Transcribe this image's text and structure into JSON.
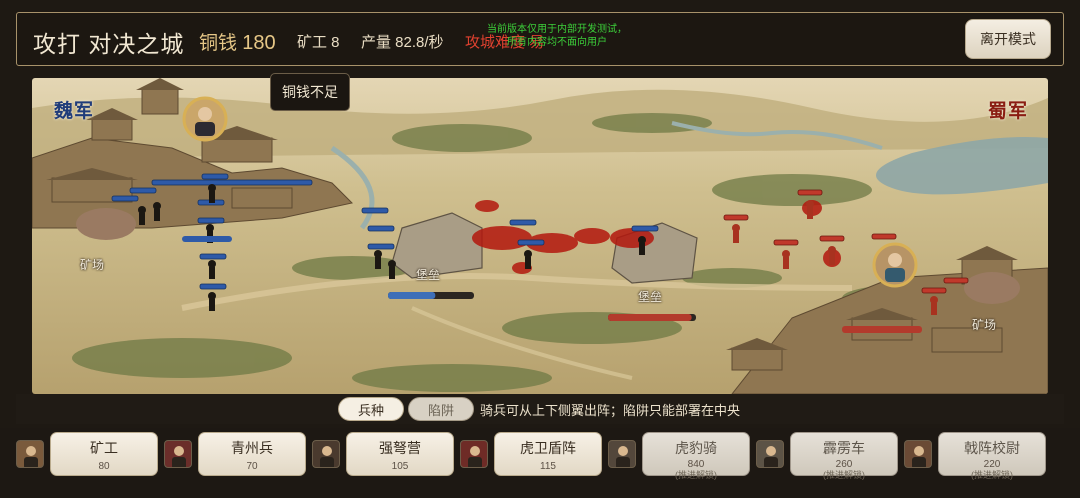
{
  "header": {
    "title": "攻打 对决之城",
    "copper_label": "铜钱",
    "copper_value": "180",
    "miners": "矿工 8",
    "rate": "产量 82.8/秒",
    "difficulty": "攻城难度 易",
    "dev_notice_line1": "当前版本仅用于内部开发测试，",
    "dev_notice_line2": "所有内容均不面向用户",
    "leave_button": "离开模式"
  },
  "battlefield": {
    "army_left": "魏军",
    "army_right": "蜀军",
    "mine_left": "矿场",
    "mine_right": "矿场",
    "fort_left": "堡垒",
    "fort_right": "堡垒",
    "left_fort_health": 0.55,
    "right_fort_health": 0.95
  },
  "tooltip": "铜钱不足",
  "tabs": {
    "units": "兵种",
    "traps": "陷阱",
    "hint": "骑兵可从上下侧翼出阵；陷阱只能部署在中央"
  },
  "units": [
    {
      "name": "矿工",
      "cost": "80",
      "locked": false,
      "lock_text": ""
    },
    {
      "name": "青州兵",
      "cost": "70",
      "locked": false,
      "lock_text": ""
    },
    {
      "name": "强弩营",
      "cost": "105",
      "locked": false,
      "lock_text": ""
    },
    {
      "name": "虎卫盾阵",
      "cost": "115",
      "locked": false,
      "lock_text": ""
    },
    {
      "name": "虎豹骑",
      "cost": "840",
      "locked": true,
      "lock_text": "(推进解锁)"
    },
    {
      "name": "霹雳车",
      "cost": "260",
      "locked": true,
      "lock_text": "(推进解锁)"
    },
    {
      "name": "戟阵校尉",
      "cost": "220",
      "locked": true,
      "lock_text": "(推进解锁)"
    }
  ],
  "colors": {
    "wei": "#2e5aa8",
    "shu": "#c0392b",
    "difficulty": "#e0412f",
    "dev_notice": "#3ccf3a",
    "copper": "#e6c787"
  }
}
